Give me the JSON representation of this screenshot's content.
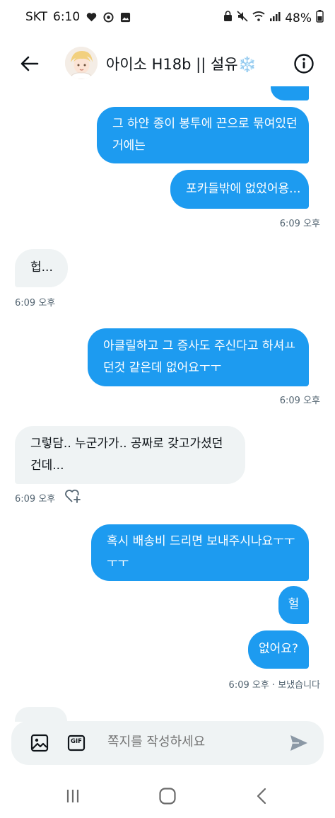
{
  "status_bar": {
    "carrier": "SKT",
    "time": "6:10",
    "battery": "48%",
    "icons": [
      "heart-icon",
      "circle-icon",
      "gallery-icon",
      "lock-icon",
      "mute-icon",
      "wifi-icon",
      "signal-icon",
      "battery-icon"
    ]
  },
  "header": {
    "title": "아이소 H18b || 설유",
    "title_emoji": "❄️"
  },
  "messages": [
    {
      "type": "sent",
      "lines": [
        "그 하얀 종이 봉투에 끈으로 묶여있던",
        "거에는"
      ]
    },
    {
      "type": "sent",
      "lines": [
        "포카들밖에 없었어용..."
      ]
    },
    {
      "type": "meta",
      "text": "6:09 오후"
    },
    {
      "type": "recv",
      "lines": [
        "헙..."
      ]
    },
    {
      "type": "meta",
      "text": "6:09 오후"
    },
    {
      "type": "sent",
      "lines": [
        "아클릴하고 그 증사도 주신다고 하셔ㅛ",
        "던것 같은데 없어요ㅜㅜ"
      ]
    },
    {
      "type": "meta",
      "text": "6:09 오후"
    },
    {
      "type": "recv",
      "lines": [
        "그렇담.. 누군가가.. 공짜로 갖고가셨던",
        "건데..."
      ]
    },
    {
      "type": "meta",
      "text": "6:09 오후"
    },
    {
      "type": "sent",
      "lines": [
        "혹시 배송비 드리면 보내주시나요ㅜㅜ",
        "ㅜㅜ"
      ]
    },
    {
      "type": "sent",
      "lines": [
        "헐"
      ]
    },
    {
      "type": "sent",
      "lines": [
        "없어요?"
      ]
    },
    {
      "type": "meta",
      "text": "6:09 오후 · 보냈습니다"
    }
  ],
  "composer": {
    "placeholder": "쪽지를 작성하세요",
    "gif_label": "GIF"
  },
  "colors": {
    "sent_bubble": "#1d9bf0",
    "received_bubble": "#eff3f4",
    "meta_text": "#536471"
  }
}
